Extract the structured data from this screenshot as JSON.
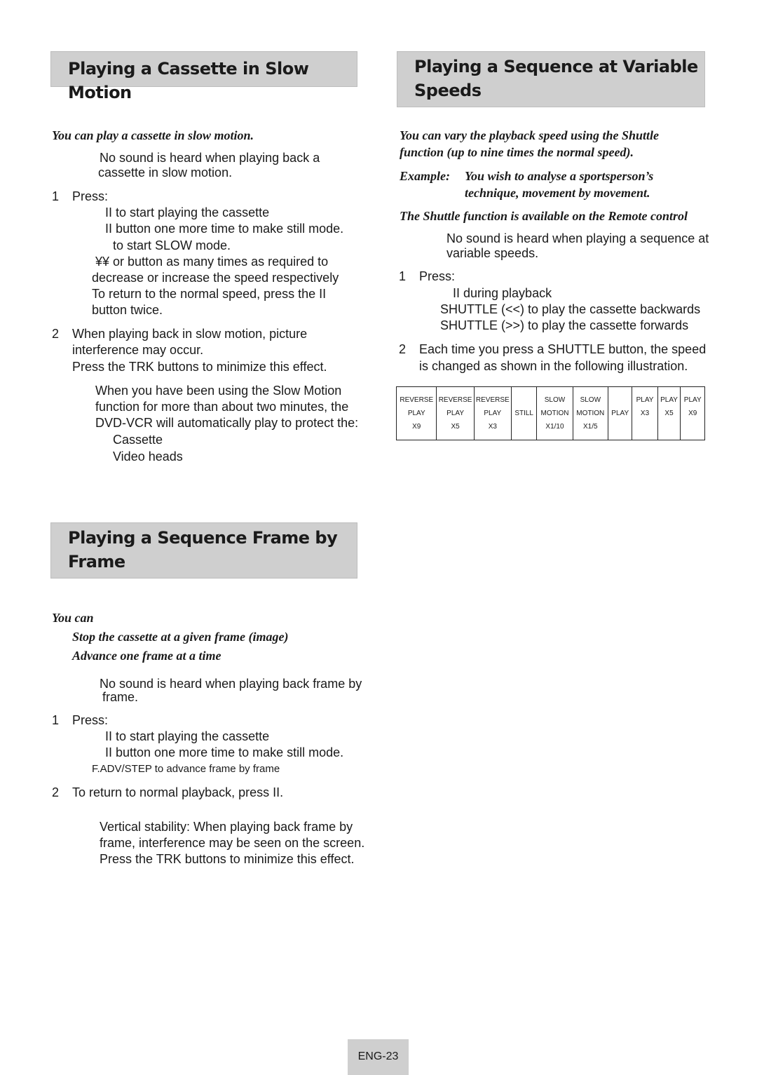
{
  "sections": {
    "slow": {
      "title": "Playing a Cassette in Slow Motion",
      "intro": "You can play a cassette in slow motion.",
      "lines": [
        "No sound is heard when playing back a",
        "cassette in slow motion.",
        "1",
        "Press:",
        "II to start playing the cassette",
        "II button one more time to make still mode.",
        "to start SLOW mode.",
        "¥¥ or      button as many times as required to",
        "decrease or increase the speed respectively",
        "To return to the normal speed, press the    II",
        "button twice.",
        "2",
        "When playing back in slow motion, picture",
        "interference may occur.",
        "Press the TRK buttons to minimize this effect.",
        "When you have been using the Slow Motion",
        "function for more than about two minutes, the",
        "DVD-VCR will automatically play to protect the:",
        "Cassette",
        "Video heads"
      ]
    },
    "variable": {
      "title_lines": [
        "Playing a Sequence at Variable",
        "Speeds"
      ],
      "italic": [
        "You can vary the playback speed using the Shuttle",
        "function (up to nine times the normal speed).",
        "Example:",
        "You wish to analyse a sportsperson’s",
        "technique, movement by movement.",
        "The Shuttle function is available on the Remote control"
      ],
      "lines": [
        "No sound is heard when playing a sequence at",
        "variable speeds.",
        "1",
        "Press:",
        "II during playback",
        "SHUTTLE (<<) to play the cassette backwards",
        "SHUTTLE (>>) to play the cassette forwards",
        "2",
        "Each time you press a SHUTTLE button, the speed",
        "is changed as shown in the following illustration."
      ],
      "speed_table": [
        [
          "REVERSE",
          "PLAY",
          "X9"
        ],
        [
          "REVERSE",
          "PLAY",
          "X5"
        ],
        [
          "REVERSE",
          "PLAY",
          "X3"
        ],
        [
          "",
          "STILL",
          ""
        ],
        [
          "SLOW",
          "MOTION",
          "X1/10"
        ],
        [
          "SLOW",
          "MOTION",
          "X1/5"
        ],
        [
          "",
          "PLAY",
          ""
        ],
        [
          "PLAY",
          "X3",
          ""
        ],
        [
          "PLAY",
          "X5",
          ""
        ],
        [
          "PLAY",
          "X9",
          ""
        ]
      ]
    },
    "frame": {
      "title_lines": [
        "Playing a Sequence Frame by",
        "Frame"
      ],
      "italic": [
        "You can",
        "Stop the cassette at a given frame (image)",
        "Advance one frame at a time"
      ],
      "lines": [
        "No sound is heard when playing back frame by",
        "frame.",
        "1",
        "Press:",
        "II to start playing the cassette",
        "II button one more time to make still mode.",
        "F.ADV/STEP to advance frame by frame",
        "2",
        "To return to normal playback, press    II.",
        "Vertical stability: When playing back frame by",
        "frame, interference may be seen on the screen.",
        "Press the TRK buttons to minimize this effect."
      ]
    }
  },
  "footer": {
    "page": "ENG-23"
  }
}
